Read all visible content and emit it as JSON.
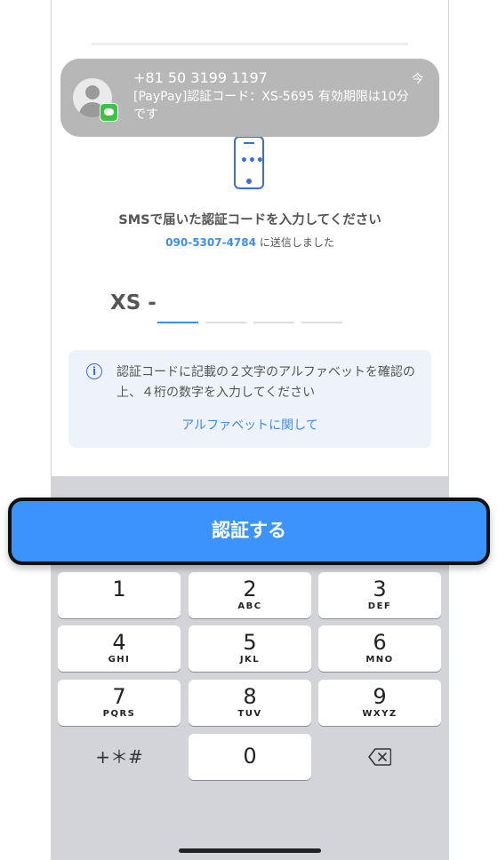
{
  "notification": {
    "sender": "+81 50 3199 1197",
    "time": "今",
    "body": "[PayPay]認証コード：XS-5695 有効期限は10分です",
    "icon": "messages-icon"
  },
  "screen": {
    "title": "SMSで届いた認証コードを入力してください",
    "phone_number": "090-5307-4784",
    "sent_suffix": "に送信しました",
    "code_prefix": "XS -",
    "info_text": "認証コードに記載の２文字のアルファベットを確認の上、４桁の数字を入力してください",
    "info_link": "アルファベットに関して"
  },
  "verify_button": {
    "label": "認証する",
    "color": "#3b93fb"
  },
  "keyboard": {
    "keys": [
      {
        "digit": "1",
        "letters": ""
      },
      {
        "digit": "2",
        "letters": "ABC"
      },
      {
        "digit": "3",
        "letters": "DEF"
      },
      {
        "digit": "4",
        "letters": "GHI"
      },
      {
        "digit": "5",
        "letters": "JKL"
      },
      {
        "digit": "6",
        "letters": "MNO"
      },
      {
        "digit": "7",
        "letters": "PQRS"
      },
      {
        "digit": "8",
        "letters": "TUV"
      },
      {
        "digit": "9",
        "letters": "WXYZ"
      }
    ],
    "symbols": "+＊#",
    "zero": "0"
  },
  "colors": {
    "accent": "#3d8ee8",
    "icon_blue": "#3d6ed4",
    "text": "#555555"
  }
}
